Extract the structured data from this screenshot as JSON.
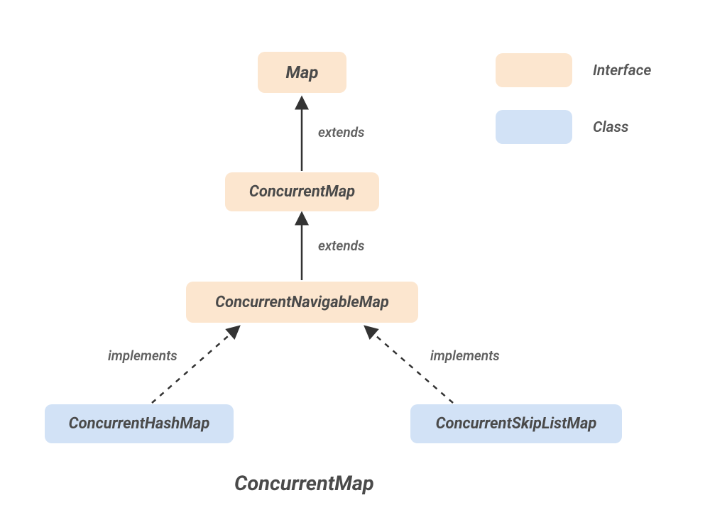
{
  "nodes": {
    "map": {
      "label": "Map",
      "type": "interface"
    },
    "concurrentMap": {
      "label": "ConcurrentMap",
      "type": "interface"
    },
    "concurrentNavigableMap": {
      "label": "ConcurrentNavigableMap",
      "type": "interface"
    },
    "concurrentHashMap": {
      "label": "ConcurrentHashMap",
      "type": "class"
    },
    "concurrentSkipListMap": {
      "label": "ConcurrentSkipListMap",
      "type": "class"
    }
  },
  "edges": {
    "mapExtends": {
      "label": "extends",
      "from": "concurrentMap",
      "to": "map",
      "style": "solid"
    },
    "concurrentMapExtends": {
      "label": "extends",
      "from": "concurrentNavigableMap",
      "to": "concurrentMap",
      "style": "solid"
    },
    "hashMapImplements": {
      "label": "implements",
      "from": "concurrentHashMap",
      "to": "concurrentNavigableMap",
      "style": "dashed"
    },
    "skipListImplements": {
      "label": "implements",
      "from": "concurrentSkipListMap",
      "to": "concurrentNavigableMap",
      "style": "dashed"
    }
  },
  "legend": {
    "interface": "Interface",
    "class": "Class"
  },
  "title": "ConcurrentMap"
}
